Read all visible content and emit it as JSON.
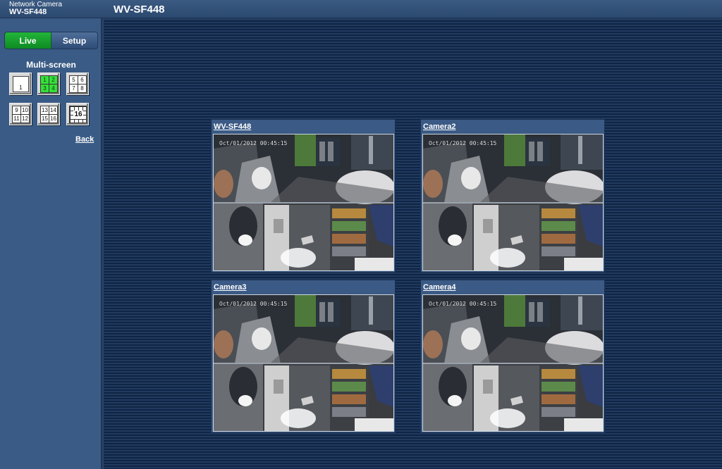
{
  "header": {
    "subtitle": "Network Camera",
    "model": "WV-SF448",
    "title": "WV-SF448"
  },
  "sidebar": {
    "tabs": [
      {
        "label": "Live",
        "active": true
      },
      {
        "label": "Setup",
        "active": false
      }
    ],
    "multiscreen_label": "Multi-screen",
    "layouts": [
      {
        "name": "single",
        "cells": [
          "1"
        ]
      },
      {
        "name": "quad-1-4",
        "cells": [
          "1",
          "2",
          "3",
          "4"
        ],
        "active": true
      },
      {
        "name": "quad-5-8",
        "cells": [
          "5",
          "6",
          "7",
          "8"
        ]
      },
      {
        "name": "quad-9-12",
        "cells": [
          "9",
          "10",
          "11",
          "12"
        ]
      },
      {
        "name": "quad-13-16",
        "cells": [
          "13",
          "14",
          "15",
          "16"
        ]
      },
      {
        "name": "sixteen",
        "cells": [
          "16"
        ]
      }
    ],
    "back_label": "Back"
  },
  "cameras": [
    {
      "name": "WV-SF448",
      "timestamp": "Oct/01/2012   00:45:15"
    },
    {
      "name": "Camera2",
      "timestamp": "Oct/01/2012   00:45:15"
    },
    {
      "name": "Camera3",
      "timestamp": "Oct/01/2012   00:45:15"
    },
    {
      "name": "Camera4",
      "timestamp": "Oct/01/2012   00:45:15"
    }
  ],
  "colors": {
    "live_tab": "#16a02e",
    "active_layout": "#35e03a",
    "background": "#0f2545"
  }
}
